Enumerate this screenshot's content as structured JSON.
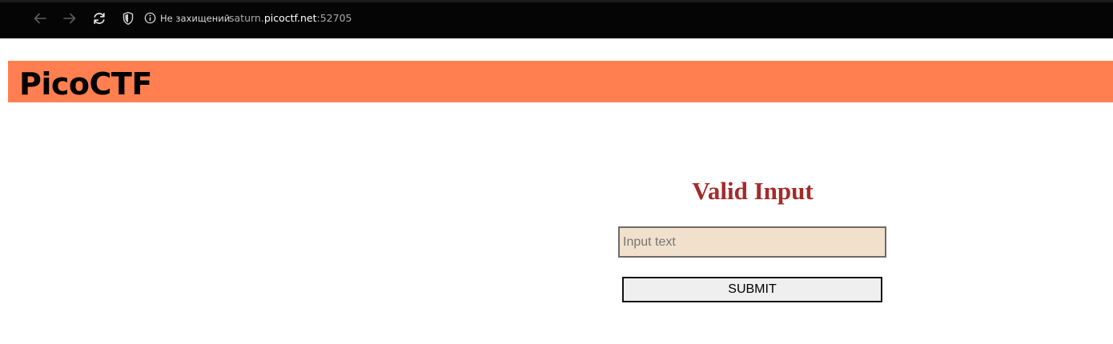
{
  "browser": {
    "security_label": "Не захищений",
    "url_subdomain": "saturn.",
    "url_host": "picoctf.net",
    "url_port": ":52705",
    "icons": [
      "back-arrow-icon",
      "forward-arrow-icon",
      "reload-icon",
      "shield-icon",
      "info-icon"
    ]
  },
  "header": {
    "title": "PicoCTF",
    "background": "#ff7f50"
  },
  "form": {
    "title": "Valid Input",
    "title_color": "#a52a2a",
    "input_placeholder": "Input text",
    "input_value": "",
    "input_background": "#f1e1cc",
    "submit_label": "SUBMIT"
  }
}
